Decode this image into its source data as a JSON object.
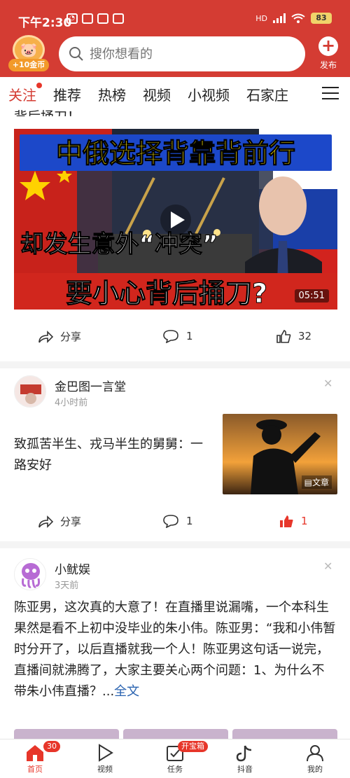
{
  "status_bar": {
    "time": "下午2:30",
    "battery": "83",
    "network": "HD"
  },
  "header": {
    "coin_label": "+10金币",
    "search_placeholder": "搜你想看的",
    "publish_label": "发布"
  },
  "tabs": [
    {
      "label": "关注",
      "active": true,
      "has_dot": true
    },
    {
      "label": "推荐"
    },
    {
      "label": "热榜"
    },
    {
      "label": "视频"
    },
    {
      "label": "小视频"
    },
    {
      "label": "石家庄"
    }
  ],
  "feed": [
    {
      "cut_title": "背后捅刀！",
      "video_title_top": "中俄选择背靠背前行",
      "video_title_mid": "却发生意外“冲突”",
      "video_title_bottom": "要小心背后捅刀?",
      "duration": "05:51",
      "share_label": "分享",
      "comment_count": "1",
      "like_count": "32"
    },
    {
      "author": "金巴图一言堂",
      "time_ago": "4小时前",
      "text": "致孤苦半生、戎马半生的舅舅：一路安好",
      "thumb_badge": "文章",
      "share_label": "分享",
      "comment_count": "1",
      "like_count": "1"
    },
    {
      "author": "小鱿娱",
      "time_ago": "3天前",
      "text": "陈亚男，这次真的大意了！在直播里说漏嘴，一个本科生果然是看不上初中没毕业的朱小伟。陈亚男：“我和小伟暂时分开了，以后直播就我一个人！陈亚男这句话一说完，直播间就沸腾了，大家主要关心两个问题：1、为什么不带朱小伟直播？...",
      "more_label": "全文"
    }
  ],
  "bottom_nav": [
    {
      "label": "首页",
      "badge": "30",
      "active": true
    },
    {
      "label": "视频"
    },
    {
      "label": "任务",
      "badge": "开宝箱"
    },
    {
      "label": "抖音"
    },
    {
      "label": "我的"
    }
  ],
  "colors": {
    "brand_red": "#d43c33",
    "link_blue": "#2a63b0",
    "like_red": "#e7362a"
  }
}
